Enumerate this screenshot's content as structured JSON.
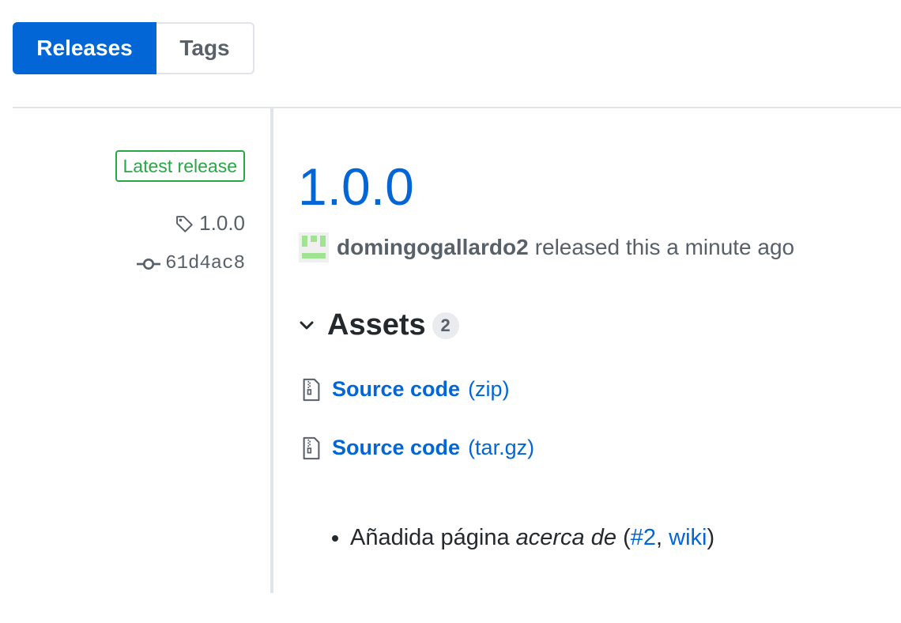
{
  "tabs": {
    "releases": "Releases",
    "tags": "Tags"
  },
  "sidebar": {
    "latest_label": "Latest release",
    "tag": "1.0.0",
    "commit": "61d4ac8"
  },
  "release": {
    "title": "1.0.0",
    "author": "domingogallardo2",
    "released_text": "released this a minute ago"
  },
  "assets": {
    "title": "Assets",
    "count": "2",
    "items": [
      {
        "name": "Source code",
        "ext": "(zip)"
      },
      {
        "name": "Source code",
        "ext": "(tar.gz)"
      }
    ]
  },
  "notes": {
    "text": "Añadida página",
    "italic": "acerca de",
    "open": "(",
    "link1": "#2",
    "sep": ",",
    "link2": "wiki",
    "close": ")"
  },
  "colors": {
    "accent": "#0366d6",
    "latest": "#28a745",
    "avatar": "#a0e393"
  },
  "icons": {
    "tag": "tag-icon",
    "commit": "git-commit-icon",
    "chevron": "chevron-down-icon",
    "archive": "file-zip-icon"
  }
}
